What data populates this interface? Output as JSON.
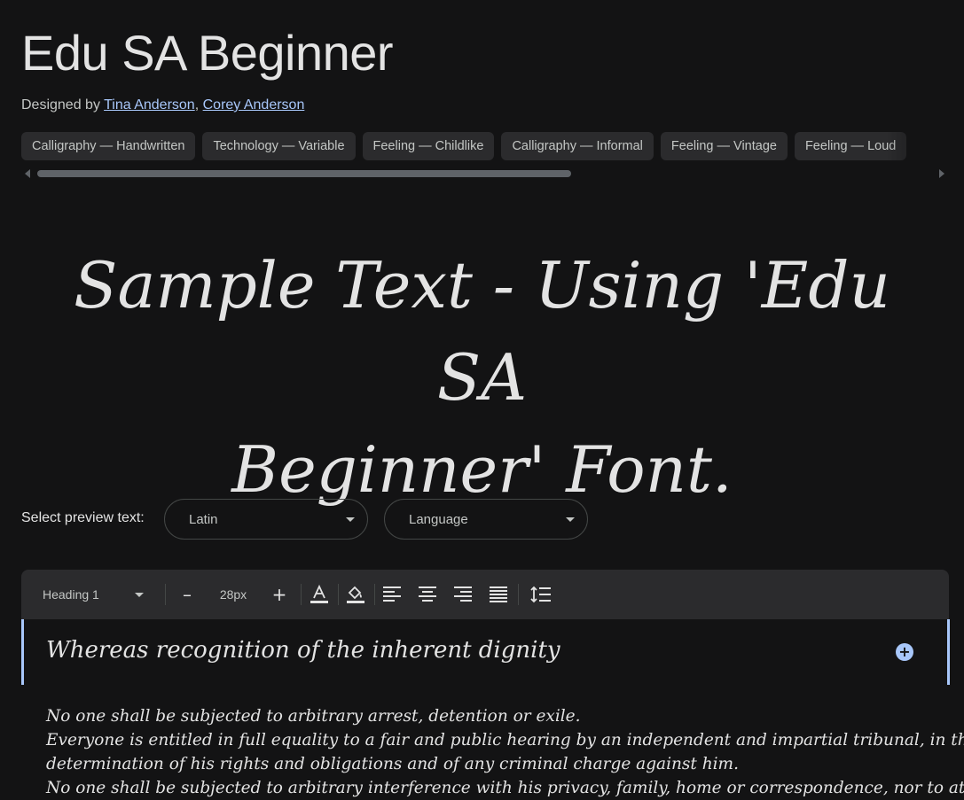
{
  "header": {
    "title": "Edu SA Beginner",
    "designed_by": "Designed by",
    "designers": [
      "Tina Anderson",
      "Corey Anderson"
    ],
    "separator": ","
  },
  "tags": [
    "Calligraphy — Handwritten",
    "Technology — Variable",
    "Feeling — Childlike",
    "Calligraphy — Informal",
    "Feeling — Vintage",
    "Feeling — Loud"
  ],
  "sample": {
    "line1": "Sample Text - Using 'Edu SA",
    "line2": "Beginner' Font."
  },
  "preview": {
    "label": "Select preview text:",
    "script_value": "Latin",
    "language_placeholder": "Language"
  },
  "toolbar": {
    "style_value": "Heading 1",
    "decrease_label": "–",
    "size_value": "28px",
    "increase_label": "+",
    "text_color_icon": "text-color-icon",
    "highlight_icon": "paint-bucket-icon",
    "align_icons": [
      "align-left-icon",
      "align-center-icon",
      "align-right-icon",
      "align-justify-icon"
    ],
    "line_height_icon": "line-height-icon"
  },
  "editor": {
    "heading": "Whereas recognition of the inherent dignity",
    "add_icon": "plus-circle-icon",
    "body_lines": [
      "No one shall be subjected to arbitrary arrest, detention or exile.",
      "Everyone is entitled in full equality to a fair and public hearing by an independent and impartial tribunal, in the",
      "determination of his rights and obligations and of any criminal charge against him.",
      "No one shall be subjected to arbitrary interference with his privacy, family, home or correspondence, nor to attacks"
    ]
  },
  "colors": {
    "background": "#131314",
    "surface": "#2b2b2d",
    "accent": "#a8c7fa",
    "text": "#e3e3e3"
  }
}
